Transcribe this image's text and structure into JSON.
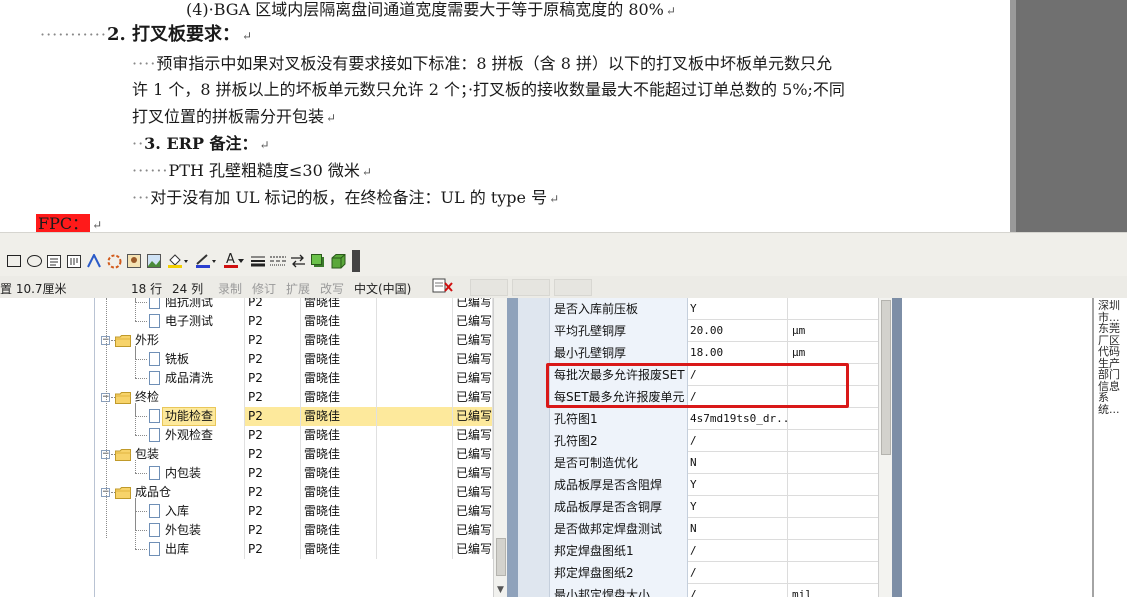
{
  "document": {
    "line1": "(4)·BGA 区域内层隔离盘间通道宽度需要大于等于原稿宽度的 80%",
    "heading2": "2. 打叉板要求：",
    "para_a": "预审指示中如果对叉板没有要求接如下标准：8 拼板（含 8 拼）以下的打叉板中坏板单元数只允",
    "para_b": "许 1 个，8 拼板以上的坏板单元数只允许 2 个；·打叉板的接收数量最大不能超过订单总数的 5%;不同",
    "para_c": "打叉位置的拼板需分开包装",
    "heading3": "3. ERP 备注：",
    "erp_line1": "PTH 孔壁粗糙度≤30 微米",
    "erp_line2": "对于没有加 UL 标记的板，在终检备注：UL 的 type 号",
    "fpc_label": "FPC：",
    "para_mark": "↵"
  },
  "toolbar": {
    "icons": [
      "rectangle-icon",
      "ellipse-icon",
      "textbox-icon",
      "vertical-textbox-icon",
      "wordart-icon",
      "diagram-icon",
      "clipart-icon",
      "picture-icon",
      "fill-color-icon",
      "line-color-icon",
      "font-color-icon",
      "line-style-icon",
      "dash-style-icon",
      "arrow-style-icon",
      "shadow-icon",
      "3d-icon"
    ],
    "font_color_glyph": "A"
  },
  "statusbar": {
    "position": "置 10.7厘米",
    "row": "18 行",
    "col": "24 列",
    "rec": "录制",
    "trk": "修订",
    "ext": "扩展",
    "ovr": "改写",
    "lang": "中文(中国)"
  },
  "tree": {
    "rows": [
      {
        "name": "阻抗测试",
        "p": "P2",
        "user": "雷晓佳",
        "status": "已编写",
        "type": "doc",
        "level": 2
      },
      {
        "name": "电子测试",
        "p": "P2",
        "user": "雷晓佳",
        "status": "已编写",
        "type": "doc",
        "level": 2
      },
      {
        "name": "外形",
        "p": "P2",
        "user": "雷晓佳",
        "status": "已编写",
        "type": "folder",
        "level": 1
      },
      {
        "name": "铣板",
        "p": "P2",
        "user": "雷晓佳",
        "status": "已编写",
        "type": "doc",
        "level": 2
      },
      {
        "name": "成品清洗",
        "p": "P2",
        "user": "雷晓佳",
        "status": "已编写",
        "type": "doc",
        "level": 2
      },
      {
        "name": "终检",
        "p": "P2",
        "user": "雷晓佳",
        "status": "已编写",
        "type": "folder",
        "level": 1
      },
      {
        "name": "功能检查",
        "p": "P2",
        "user": "雷晓佳",
        "status": "已编写",
        "type": "doc",
        "level": 2,
        "selected": true
      },
      {
        "name": "外观检查",
        "p": "P2",
        "user": "雷晓佳",
        "status": "已编写",
        "type": "doc",
        "level": 2
      },
      {
        "name": "包装",
        "p": "P2",
        "user": "雷晓佳",
        "status": "已编写",
        "type": "folder",
        "level": 1
      },
      {
        "name": "内包装",
        "p": "P2",
        "user": "雷晓佳",
        "status": "已编写",
        "type": "doc",
        "level": 2
      },
      {
        "name": "成品仓",
        "p": "P2",
        "user": "雷晓佳",
        "status": "已编写",
        "type": "folder",
        "level": 1
      },
      {
        "name": "入库",
        "p": "P2",
        "user": "雷晓佳",
        "status": "已编写",
        "type": "doc",
        "level": 2
      },
      {
        "name": "外包装",
        "p": "P2",
        "user": "雷晓佳",
        "status": "已编写",
        "type": "doc",
        "level": 2
      },
      {
        "name": "出库",
        "p": "P2",
        "user": "雷晓佳",
        "status": "已编写",
        "type": "doc",
        "level": 2
      }
    ]
  },
  "properties": {
    "rows": [
      {
        "name": "是否入库前压板",
        "value": "Y",
        "unit": ""
      },
      {
        "name": "平均孔壁铜厚",
        "value": "20.00",
        "unit": "μm"
      },
      {
        "name": "最小孔壁铜厚",
        "value": "18.00",
        "unit": "μm"
      },
      {
        "name": "每批次最多允许报废SET",
        "value": "/",
        "unit": ""
      },
      {
        "name": "每SET最多允许报废单元",
        "value": "/",
        "unit": ""
      },
      {
        "name": "孔符图1",
        "value": "4s7md19ts0_dr...",
        "unit": ""
      },
      {
        "name": "孔符图2",
        "value": "/",
        "unit": ""
      },
      {
        "name": "是否可制造优化",
        "value": "N",
        "unit": ""
      },
      {
        "name": "成品板厚是否含阻焊",
        "value": "Y",
        "unit": ""
      },
      {
        "name": "成品板厚是否含铜厚",
        "value": "Y",
        "unit": ""
      },
      {
        "name": "是否做邦定焊盘测试",
        "value": "N",
        "unit": ""
      },
      {
        "name": "邦定焊盘图纸1",
        "value": "/",
        "unit": ""
      },
      {
        "name": "邦定焊盘图纸2",
        "value": "/",
        "unit": ""
      },
      {
        "name": "最小邦定焊盘大小",
        "value": "/",
        "unit": "mil"
      }
    ]
  },
  "side_text": "深圳市...东莞厂区代码生产部门信息系统..."
}
